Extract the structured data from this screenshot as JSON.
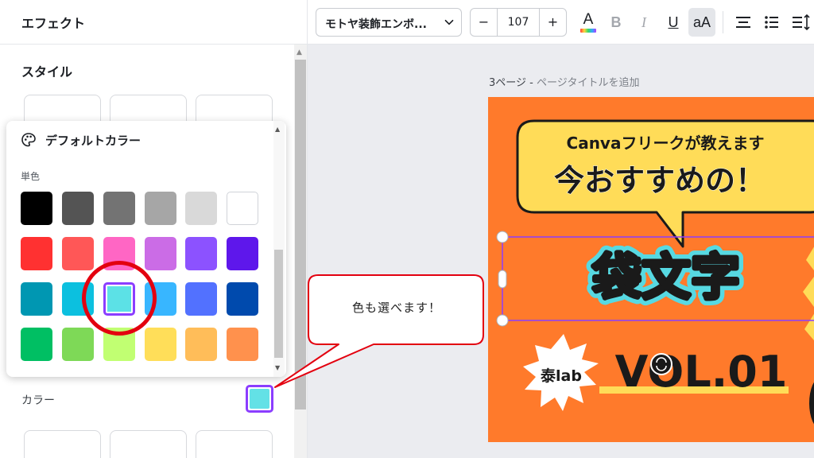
{
  "left_panel": {
    "title": "エフェクト",
    "style_heading": "スタイル",
    "color_label": "カラー",
    "selected_color": "#63e1e6"
  },
  "color_popover": {
    "title": "デフォルトカラー",
    "solid_label": "単色",
    "icon": "palette-icon",
    "rows": [
      [
        "#000000",
        "#545454",
        "#737373",
        "#a6a6a6",
        "#d9d9d9",
        "#ffffff"
      ],
      [
        "#ff3131",
        "#ff5757",
        "#ff66c4",
        "#cb6ce6",
        "#8c52ff",
        "#5e17eb"
      ],
      [
        "#0097b2",
        "#0cc0df",
        "#5ce1e6",
        "#38b6ff",
        "#5271ff",
        "#004aad"
      ],
      [
        "#00bf63",
        "#7ed957",
        "#c1ff72",
        "#ffde59",
        "#ffbd59",
        "#ff914d"
      ]
    ],
    "selected": "#5ce1e6"
  },
  "toolbar": {
    "font_name": "モトヤ装飾エンボ...",
    "font_size": "107",
    "minus": "−",
    "plus": "+",
    "text_color": "A",
    "bold": "B",
    "italic": "I",
    "underline": "U",
    "case": "aA",
    "icons": [
      "chevron-down-icon",
      "align-center-icon",
      "list-icon",
      "line-spacing-icon"
    ]
  },
  "canvas": {
    "page_number": "3ページ - ",
    "page_title_placeholder": "ページタイトルを追加"
  },
  "design": {
    "bubble_line1": "Canvaフリークが教えます",
    "bubble_line2": "今おすすめの！",
    "main_text": "袋文字",
    "badge_text": "泰lab",
    "vol_text": "VOL.01",
    "colors": {
      "background": "#ff7a2b",
      "bubble": "#ffdc58",
      "outline": "#1a1a1a",
      "main_outline": "#57d9e2",
      "selection": "#8b3dff",
      "vol_underline": "#ffdc58"
    }
  },
  "callout": {
    "text": "色も選べます！",
    "border_color": "#e3000f"
  },
  "annotation": {
    "highlight_color": "#e3000f"
  }
}
